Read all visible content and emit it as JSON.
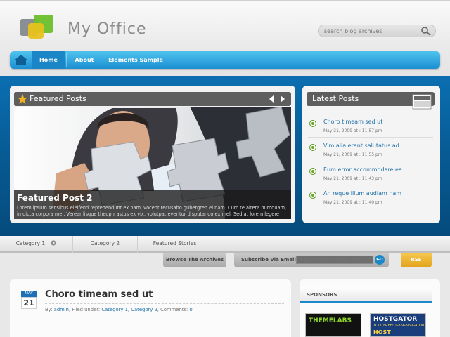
{
  "site": {
    "title": "My Office"
  },
  "search": {
    "placeholder": "search blog archives"
  },
  "nav": {
    "items": [
      {
        "label": "Home"
      },
      {
        "label": "About"
      },
      {
        "label": "Elements Sample"
      }
    ]
  },
  "featured": {
    "header": "Featured Posts",
    "caption_title": "Featured Post 2",
    "caption_text": "Lorem ipsum sensibus eleifend reprehendunt ex nam, vocent recusabo gubergren ei nam. Cum te altera numquam, in dicta corpora mel. Verear lisque theophrastus ex vix, volutpat everitur disputando ex mel. Sed at lorem legere"
  },
  "latest": {
    "header": "Latest Posts",
    "posts": [
      {
        "title": "Choro timeam sed ut",
        "date": "May 21, 2009 at : 11:57 pm"
      },
      {
        "title": "Vim alia erant salutatus ad",
        "date": "May 21, 2009 at : 11:55 pm"
      },
      {
        "title": "Eum error accommodare ea",
        "date": "May 21, 2009 at : 11:43 pm"
      },
      {
        "title": "An reque illum audiam nam",
        "date": "May 21, 2009 at : 11:40 pm"
      }
    ]
  },
  "categories": [
    {
      "label": "Category 1"
    },
    {
      "label": "Category 2"
    },
    {
      "label": "Featured Stories"
    }
  ],
  "subbar": {
    "archives": "Browse The Archives",
    "subscribe": "Subscribe Via Email",
    "email_placeholder": "Sign Up here for email feed",
    "go": "GO",
    "rss": "RSS"
  },
  "post": {
    "month": "MAY",
    "day": "21",
    "title": "Choro timeam sed ut",
    "meta_by": "By:",
    "author": "admin",
    "meta_filed": ", Filed under:",
    "cat1": "Category 1",
    "cat2": "Category 2",
    "meta_comments": ", Comments:",
    "comments": "0"
  },
  "sidebar": {
    "header": "SPONSORS",
    "ad1": "THEMELABS",
    "ad2": "HOSTGATOR",
    "ad2_line": "TOLL FREE! 1-866-96-GATOR",
    "ad2_sub": "HOST UNLIMITED"
  },
  "colors": {
    "accent": "#1d88c9",
    "band": "#075a93",
    "link": "#1e6fa8",
    "bullet": "#6aa628",
    "rss": "#e8a81e"
  }
}
